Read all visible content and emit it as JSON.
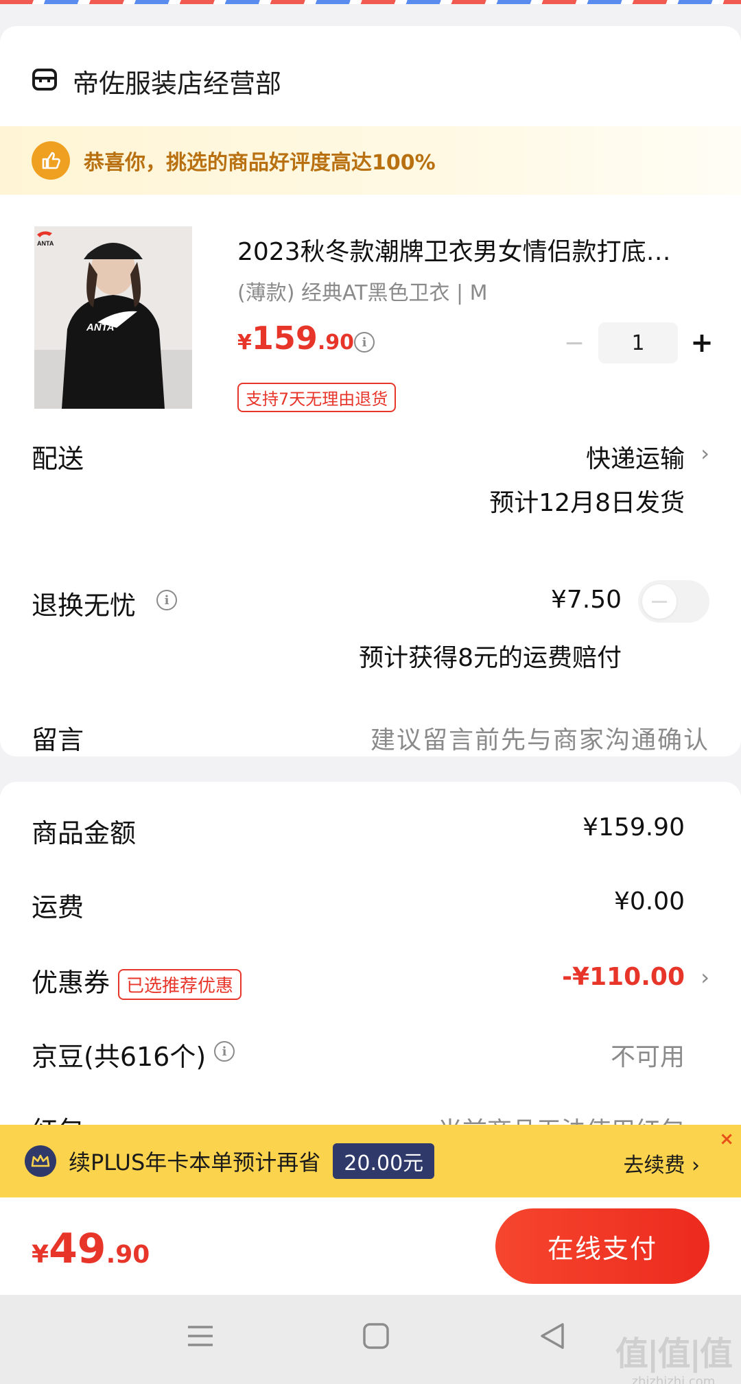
{
  "shop": {
    "name": "帝佐服装店经营部",
    "icon": "store-icon"
  },
  "banner": {
    "text": "恭喜你，挑选的商品好评度高达100%",
    "icon": "thumbs-up-icon"
  },
  "product": {
    "title": "2023秋冬款潮牌卫衣男女情侣款打底…",
    "spec": "(薄款) 经典AT黑色卫衣 | M",
    "price_currency": "¥",
    "price_int": "159",
    "price_dec": ".90",
    "quantity": "1",
    "minus": "−",
    "plus": "+",
    "return_tag": "支持7天无理由退货",
    "image_brand": "ANTA"
  },
  "delivery": {
    "label": "配送",
    "method": "快递运输",
    "eta": "预计12月8日发货"
  },
  "returns": {
    "label": "退换无忧",
    "price": "¥7.50",
    "note": "预计获得8元的运费赔付",
    "enabled": false
  },
  "message": {
    "label": "留言",
    "placeholder": "建议留言前先与商家沟通确认"
  },
  "summary": {
    "goods_label": "商品金额",
    "goods_value": "¥159.90",
    "shipping_label": "运费",
    "shipping_value": "¥0.00",
    "coupon_label": "优惠券",
    "coupon_tag": "已选推荐优惠",
    "coupon_value": "-¥110.00",
    "beans_label": "京豆(共616个)",
    "beans_value": "不可用",
    "redpacket_label": "红包",
    "redpacket_value": "当前商品无法使用红包"
  },
  "plus_bar": {
    "text": "续PLUS年卡本单预计再省",
    "amount": "20.00元",
    "renew": "去续费 ›",
    "close": "×"
  },
  "pay": {
    "currency": "¥",
    "int": "49",
    "dec": ".90",
    "button": "在线支付"
  },
  "watermark": {
    "big": "值|值|值",
    "small": "zhizhizhi.com"
  },
  "colors": {
    "accent": "#e8352a",
    "plus_yellow": "#fcd34d",
    "plus_navy": "#2f3a6b"
  }
}
